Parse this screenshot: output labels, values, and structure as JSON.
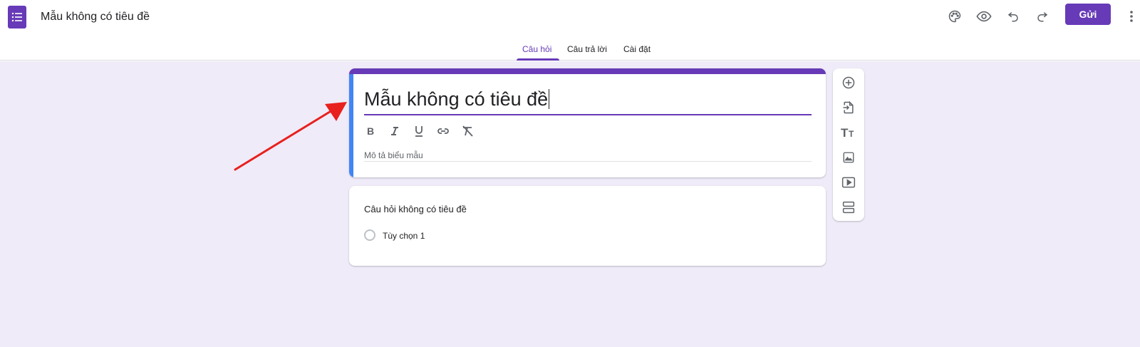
{
  "header": {
    "doc_title": "Mẫu không có tiêu đề",
    "send_label": "Gửi"
  },
  "tabs": [
    {
      "label": "Câu hỏi",
      "active": true
    },
    {
      "label": "Câu trả lời",
      "active": false
    },
    {
      "label": "Cài đặt",
      "active": false
    }
  ],
  "form": {
    "title": "Mẫu không có tiêu đề",
    "description_placeholder": "Mô tả biểu mẫu",
    "format_buttons": [
      "bold-icon",
      "italic-icon",
      "underline-icon",
      "link-icon",
      "clear-format-icon"
    ]
  },
  "question": {
    "title": "Câu hỏi không có tiêu đề",
    "option_label": "Tùy chọn 1"
  },
  "toolbar": {
    "items": [
      "add-question-icon",
      "import-questions-icon",
      "add-title-icon",
      "add-image-icon",
      "add-video-icon",
      "add-section-icon"
    ]
  },
  "colors": {
    "accent": "#673ab7",
    "canvas_bg": "#f0ebf8",
    "focus_bar": "#4285f4",
    "annotation_arrow": "#e8201e"
  }
}
